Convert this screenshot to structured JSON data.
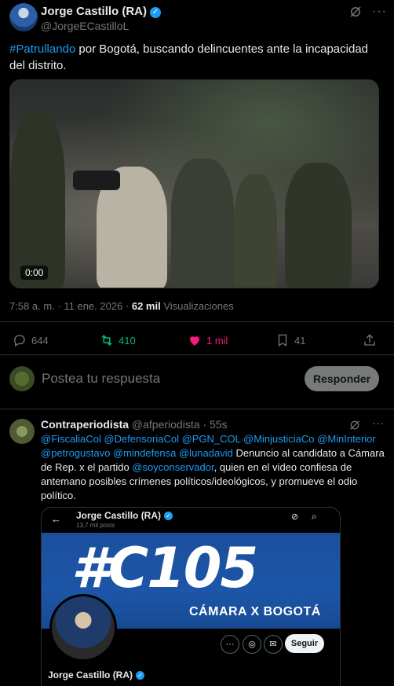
{
  "tweet": {
    "author_name": "Jorge Castillo (RA)",
    "author_handle": "@JorgeECastilloL",
    "text_hashtag": "#Patrullando",
    "text_body": " por Bogotá, buscando delincuentes ante la incapacidad del distrito.",
    "video_time": "0:00",
    "time": "7:58 a. m. · 11 ene. 2026 · ",
    "views_count": "62 mil",
    "views_label": " Visualizaciones"
  },
  "actions": {
    "replies": "644",
    "reposts": "410",
    "likes": "1 mil",
    "bookmarks": "41"
  },
  "reply_box": {
    "placeholder": "Postea tu respuesta",
    "button": "Responder"
  },
  "reply": {
    "name": "Contraperiodista",
    "handle": "@afperiodista",
    "time": " · 55s",
    "mentions": "@FiscaliaCol @DefensoriaCol @PGN_COL @MinjusticiaCo @MinInterior @petrogustavo @mindefensa @lunadavid",
    "text_a": " Denuncio al candidato a Cámara de Rep. x el partido ",
    "mention2": "@soyconservador",
    "text_b": ", quien en el video confiesa de antemano posibles crímenes políticos/ideológicos, y promueve el odio político.",
    "embed": {
      "profile_name": "Jorge Castillo (RA)",
      "posts": "13,7 mil posts",
      "banner_main": "#C105",
      "banner_sub": "CÁMARA X BOGOTÁ",
      "follow": "Seguir",
      "bottom_name": "Jorge Castillo (RA)"
    }
  },
  "colors": {
    "accent": "#1d9bf0",
    "repost": "#00ba7c",
    "like": "#f91880",
    "background": "#000000"
  }
}
